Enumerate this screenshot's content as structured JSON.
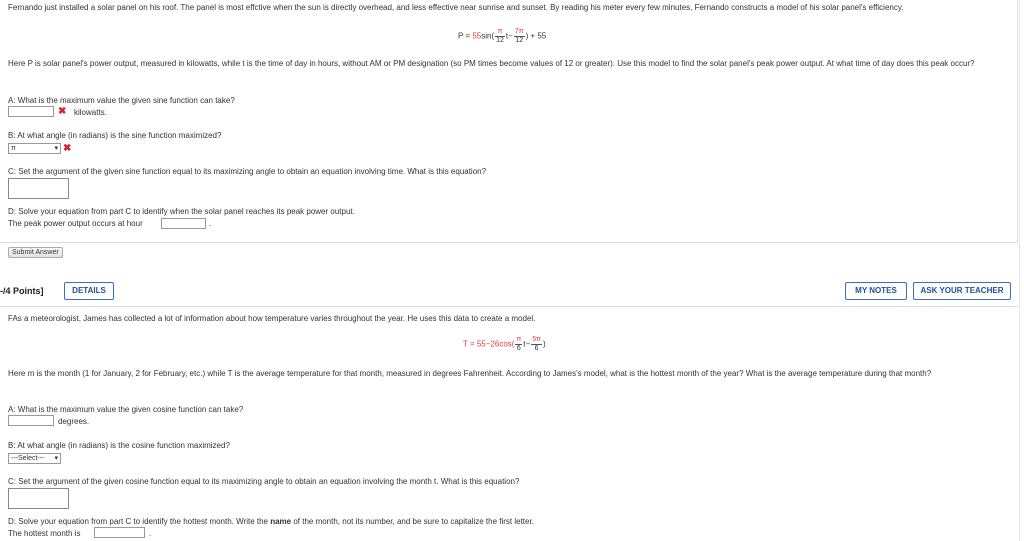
{
  "q1": {
    "intro": "Fernando just installed a solar panel on his roof. The panel is most effctive when the sun is directly overhead, and less effective near sunrise and sunset. By reading his meter every few minutes, Fernando constructs a model of his solar panel's efficiency.",
    "formula": {
      "lhs": "P =",
      "coef": "55",
      "fn": "sin(",
      "frac1_num": "π",
      "frac1_den": "12",
      "mid": "t−",
      "frac2_num": "7π",
      "frac2_den": "12",
      "rhs": ") + 55"
    },
    "description": "Here P is solar panel's power output, measured in kilowatts, while t is the time of day in hours, without AM or PM designation (so PM times become values of 12 or greater). Use this model to find the solar panel's peak power output. At what time of day does this peak occur?",
    "partA": {
      "label": "A: What is the maximum value the given sine function can take?",
      "unit": "kilowatts.",
      "value": ""
    },
    "partB": {
      "label": "B: At what angle (in radians) is the sine function maximized?",
      "selected": "π"
    },
    "partC": {
      "label": "C: Set the argument of the given sine function equal to its maximizing angle to obtain an equation involving time. What is this equation?"
    },
    "partD": {
      "label": "D: Solve your equation from part C to identify when the solar panel reaches its peak power output.",
      "answer_prefix": "The peak power output occurs at hour",
      "answer_suffix": "."
    },
    "submit_label": "Submit Answer"
  },
  "q2": {
    "points": "-/4 Points]",
    "details_label": "DETAILS",
    "my_notes_label": "MY NOTES",
    "ask_teacher_label": "ASK YOUR TEACHER",
    "intro": "FAs a meteorologist, James has collected a lot of information about how temperature varies throughout the year. He uses this data to create a model.",
    "formula": {
      "lhs": "T = 55−26cos(",
      "frac1_num": "π",
      "frac1_den": "6",
      "mid": "t−",
      "frac2_num": "5π",
      "frac2_den": "6",
      "rhs": ")"
    },
    "description": "Here m is the month (1 for January, 2 for February, etc.) while T is the average temperature for that month, measured in degrees Fahrenheit. According to James's model, what is the hottest month of the year? What is the average temperature during that month?",
    "partA": {
      "label": "A: What is the maximum value the given cosine function can take?",
      "unit": "degrees."
    },
    "partB": {
      "label": "B: At what angle (in radians) is the cosine function maximized?",
      "selected": "---Select---"
    },
    "partC": {
      "label": "C: Set the argument of the given cosine function equal to its maximizing angle to obtain an equation involving the month t. What is this equation?"
    },
    "partD": {
      "label_pre": "D: Solve your equation from part C to identify the hottest month. Write the ",
      "label_bold": "name",
      "label_post": " of the month, not its number, and be sure to capitalize the first letter.",
      "answer_prefix": "The hottest month is",
      "answer_suffix": "."
    }
  },
  "colors": {
    "error_red": "#d9232a",
    "button_blue": "#1f4e99",
    "coef_red": "#e0383e"
  },
  "icons": {
    "incorrect": "x-mark-icon",
    "dropdown": "chevron-down-icon"
  }
}
